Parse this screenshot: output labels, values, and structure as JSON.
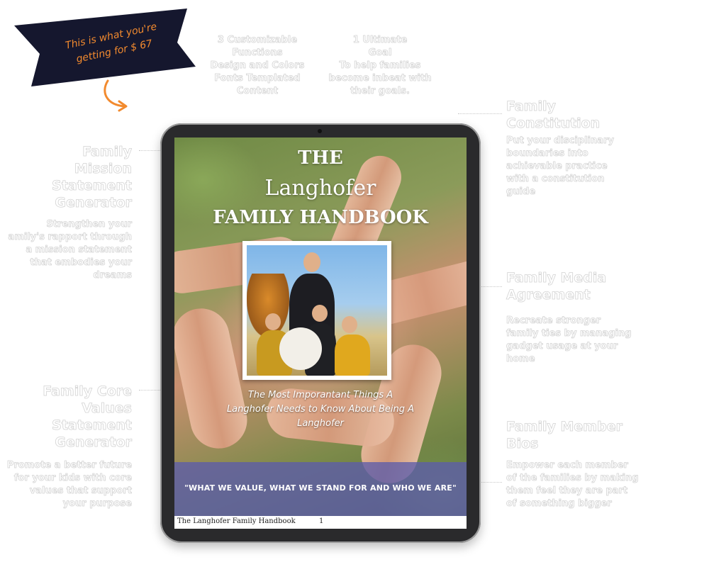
{
  "ribbon": {
    "line1": "This is what you're",
    "line2": "getting for $ 67",
    "color": "#f28a2e"
  },
  "top_features": {
    "functions": {
      "line1": "3 Customizable",
      "line2": "Functions",
      "line3": "Design and Colors",
      "line4": "Fonts Templated",
      "line5": "Content"
    },
    "goal": {
      "line1": "1 Ultimate",
      "line2": "Goal",
      "line3": "To help families",
      "line4": "become inbeat with",
      "line5": "their goals."
    }
  },
  "left_features": [
    {
      "title": [
        "Family",
        "Mission",
        "Statement",
        "Generator"
      ],
      "desc": [
        "Strengthen your",
        "amily's rapport through",
        "a mission statement",
        "that embodies your",
        "dreams"
      ]
    },
    {
      "title": [
        "Family Core",
        "Values",
        "Statement",
        "Generator"
      ],
      "desc": [
        "Promote a better future",
        "for your kids with core",
        "values that support",
        "your purpose"
      ]
    }
  ],
  "right_features": [
    {
      "title": [
        "Family",
        "Constitution"
      ],
      "desc": [
        "Put your disciplinary",
        "boundaries into",
        "achievable practice",
        "with a constitution",
        "guide"
      ]
    },
    {
      "title": [
        "Family Media",
        "Agreement"
      ],
      "desc": [
        "Recreate stronger",
        "family ties by managing",
        "gadget usage at your",
        "home"
      ]
    },
    {
      "title": [
        "Family Member",
        "Bios"
      ],
      "desc": [
        "Empower each member",
        "of the families by making",
        "them feel they are part",
        "of something bigger"
      ]
    }
  ],
  "tablet": {
    "the": "THE",
    "name": "Langhofer",
    "handbook": "FAMILY HANDBOOK",
    "subtitle": {
      "line1": "The Most Imporantant Things A",
      "line2": "Langhofer Needs to Know About Being A",
      "line3": "Langhofer"
    },
    "quote": "\"WHAT WE VALUE, WHAT WE STAND FOR AND WHO WE ARE\"",
    "footer_title": "The Langhofer Family Handbook",
    "footer_page": "1",
    "band_color": "#5c5caa"
  }
}
